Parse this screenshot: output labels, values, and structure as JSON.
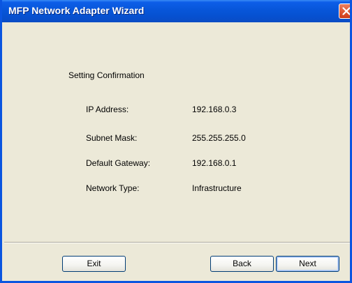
{
  "window": {
    "title": "MFP Network Adapter Wizard"
  },
  "confirmation": {
    "heading": "Setting Confirmation",
    "rows": [
      {
        "label": "IP Address:",
        "value": "192.168.0.3"
      },
      {
        "label": "Subnet Mask:",
        "value": "255.255.255.0"
      },
      {
        "label": "Default Gateway:",
        "value": "192.168.0.1"
      },
      {
        "label": "Network Type:",
        "value": "Infrastructure"
      }
    ]
  },
  "buttons": {
    "exit": "Exit",
    "back": "Back",
    "next": "Next"
  },
  "icons": {
    "close": "close-icon"
  },
  "colors": {
    "titlebar": "#0756d9",
    "dialog_bg": "#ece9d8",
    "close_button": "#e15a34"
  }
}
